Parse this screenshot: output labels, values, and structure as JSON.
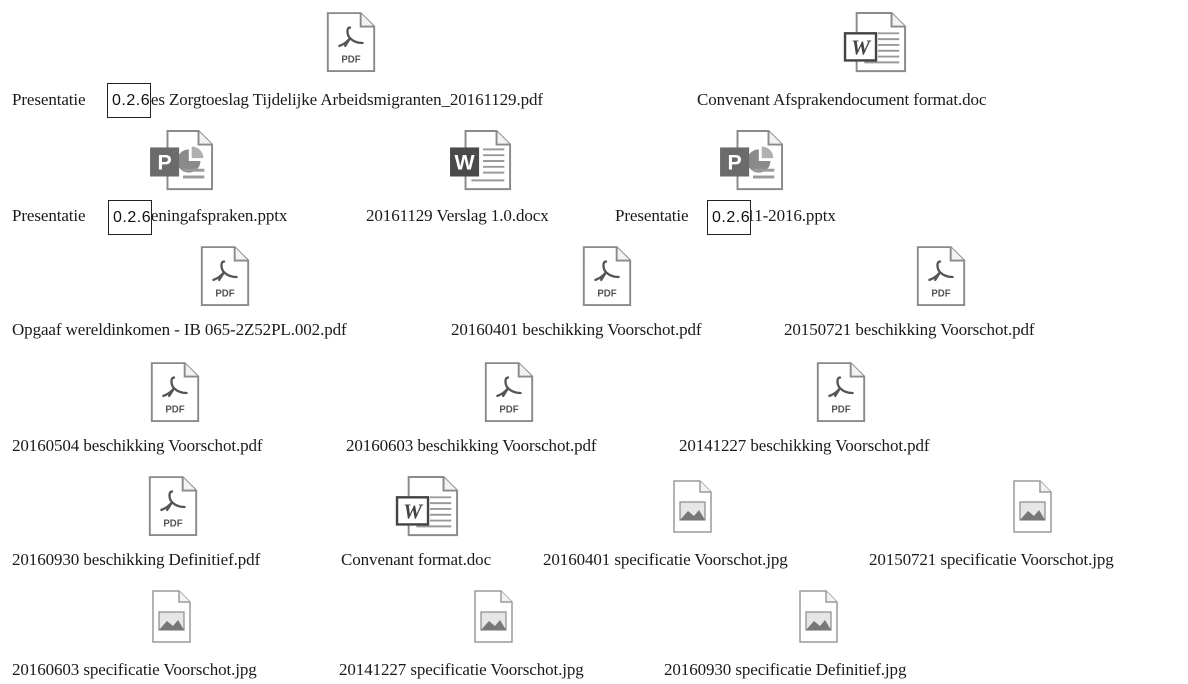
{
  "files": [
    {
      "type": "pdf",
      "pre": "Presentatie",
      "post": "roces Zorgtoeslag Tijdelijke Arbeidsmigranten_20161129.pdf"
    },
    {
      "type": "doc",
      "pre": "Convenant Afsprakendocument format.doc",
      "post": ""
    },
    {
      "type": "pptx",
      "pre": "Presentatie",
      "post": "rekeningafspraken.pptx"
    },
    {
      "type": "docx",
      "pre": "20161129 Verslag 1.0.docx",
      "post": ""
    },
    {
      "type": "pptx",
      "pre": "Presentatie",
      "post": "9-11-2016.pptx"
    },
    {
      "type": "pdf",
      "pre": "Opgaaf wereldinkomen - IB 065-2Z52PL.002.pdf",
      "post": ""
    },
    {
      "type": "pdf",
      "pre": "20160401 beschikking Voorschot.pdf",
      "post": ""
    },
    {
      "type": "pdf",
      "pre": "20150721 beschikking Voorschot.pdf",
      "post": ""
    },
    {
      "type": "pdf",
      "pre": "20160504 beschikking Voorschot.pdf",
      "post": ""
    },
    {
      "type": "pdf",
      "pre": "20160603 beschikking Voorschot.pdf",
      "post": ""
    },
    {
      "type": "pdf",
      "pre": "20141227 beschikking Voorschot.pdf",
      "post": ""
    },
    {
      "type": "pdf",
      "pre": "20160930 beschikking Definitief.pdf",
      "post": ""
    },
    {
      "type": "doc",
      "pre": "Convenant format.doc",
      "post": ""
    },
    {
      "type": "jpg",
      "pre": "20160401 specificatie Voorschot.jpg",
      "post": ""
    },
    {
      "type": "jpg",
      "pre": "20150721 specificatie Voorschot.jpg",
      "post": ""
    },
    {
      "type": "jpg",
      "pre": "20160603 specificatie Voorschot.jpg",
      "post": ""
    },
    {
      "type": "jpg",
      "pre": "20141227 specificatie Voorschot.jpg",
      "post": ""
    },
    {
      "type": "jpg",
      "pre": "20160930 specificatie Definitief.jpg",
      "post": ""
    }
  ],
  "overlays": [
    "0.2.6",
    "0.2.6",
    "0.2.6"
  ],
  "icon_text": {
    "pdf": "PDF",
    "word": "W",
    "ppt": "P"
  },
  "colors": {
    "pdf_red": "#6e6e6e",
    "word_blue": "#4a4a4a",
    "ppt_orange": "#6b6b6b"
  }
}
